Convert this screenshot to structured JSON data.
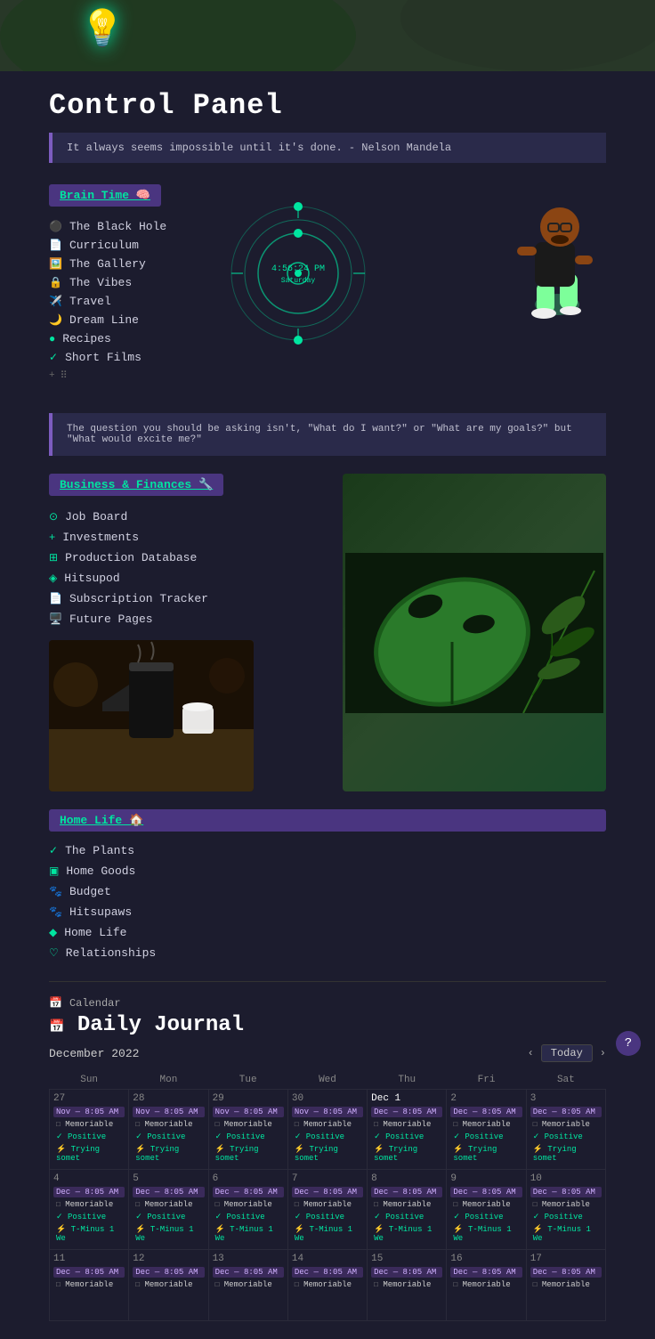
{
  "hero": {
    "alt": "Plant background hero"
  },
  "page": {
    "title": "Control Panel",
    "quote1": "It always seems impossible until it's done. - Nelson Mandela",
    "quote2": "The question you should be asking isn't, \"What do I want?\" or \"What are my goals?\" but \"What would excite me?\""
  },
  "brain_section": {
    "header": "Brain Time 🧠",
    "items": [
      {
        "icon": "⚫",
        "label": "The Black Hole",
        "icon_type": "gray"
      },
      {
        "icon": "📄",
        "label": "Curriculum",
        "icon_type": "teal"
      },
      {
        "icon": "🖼️",
        "label": "The Gallery",
        "icon_type": "teal"
      },
      {
        "icon": "🔒",
        "label": "The Vibes",
        "icon_type": "teal"
      },
      {
        "icon": "✈️",
        "label": "Travel",
        "icon_type": "teal"
      },
      {
        "icon": "🌙",
        "label": "Dream Line",
        "icon_type": "teal"
      },
      {
        "icon": "🟢",
        "label": "Recipes",
        "icon_type": "green"
      },
      {
        "icon": "✓",
        "label": "Short Films",
        "icon_type": "teal"
      }
    ]
  },
  "clock": {
    "time": "4:56:24 PM",
    "day": "Saturday"
  },
  "business_section": {
    "header": "Business & Finances 🔧",
    "items": [
      {
        "icon": "⊙",
        "label": "Job Board"
      },
      {
        "icon": "+",
        "label": "Investments"
      },
      {
        "icon": "⊞",
        "label": "Production Database"
      },
      {
        "icon": "◈",
        "label": "Hitsupod"
      },
      {
        "icon": "📄",
        "label": "Subscription Tracker"
      },
      {
        "icon": "🖥️",
        "label": "Future Pages"
      }
    ]
  },
  "home_section": {
    "header": "Home Life 🏠",
    "items": [
      {
        "icon": "✓",
        "label": "The Plants"
      },
      {
        "icon": "▣",
        "label": "Home Goods"
      },
      {
        "icon": "🐾",
        "label": "Budget"
      },
      {
        "icon": "🐾",
        "label": "Hitsupaws"
      },
      {
        "icon": "◆",
        "label": "Home Life"
      },
      {
        "icon": "♡",
        "label": "Relationships"
      }
    ]
  },
  "calendar": {
    "section_label": "Calendar",
    "journal_title": "Daily Journal",
    "month": "December 2022",
    "today_label": "Today",
    "days_of_week": [
      "Sun",
      "Mon",
      "Tue",
      "Wed",
      "Thu",
      "Fri",
      "Sat"
    ],
    "weeks": [
      [
        {
          "num": "27",
          "prev": true,
          "events": [
            {
              "type": "purple",
              "text": "Nov — 8:05 AM"
            },
            {
              "type": "check",
              "text": "Memoriable"
            },
            {
              "type": "green",
              "text": "Positive"
            },
            {
              "type": "gray",
              "text": "Trying somet"
            }
          ]
        },
        {
          "num": "28",
          "prev": true,
          "events": [
            {
              "type": "purple",
              "text": "Nov — 8:05 AM"
            },
            {
              "type": "check",
              "text": "Memoriable"
            },
            {
              "type": "green",
              "text": "Positive"
            },
            {
              "type": "gray",
              "text": "Trying somet"
            }
          ]
        },
        {
          "num": "29",
          "prev": true,
          "events": [
            {
              "type": "purple",
              "text": "Nov — 8:05 AM"
            },
            {
              "type": "check",
              "text": "Memoriable"
            },
            {
              "type": "green",
              "text": "Positive"
            },
            {
              "type": "gray",
              "text": "Trying somet"
            }
          ]
        },
        {
          "num": "30",
          "prev": true,
          "events": [
            {
              "type": "purple",
              "text": "Nov — 8:05 AM"
            },
            {
              "type": "check",
              "text": "Memoriable"
            },
            {
              "type": "green",
              "text": "Positive"
            },
            {
              "type": "gray",
              "text": "Trying somet"
            }
          ]
        },
        {
          "num": "Dec 1",
          "highlight": true,
          "events": [
            {
              "type": "purple",
              "text": "Dec — 8:05 AM"
            },
            {
              "type": "check",
              "text": "Memoriable"
            },
            {
              "type": "green",
              "text": "Positive"
            },
            {
              "type": "gray",
              "text": "Trying somet"
            }
          ]
        },
        {
          "num": "2",
          "events": [
            {
              "type": "purple",
              "text": "Dec — 8:05 AM"
            },
            {
              "type": "check",
              "text": "Memoriable"
            },
            {
              "type": "green",
              "text": "Positive"
            },
            {
              "type": "gray",
              "text": "Trying somet"
            }
          ]
        },
        {
          "num": "3",
          "events": [
            {
              "type": "purple",
              "text": "Dec — 8:05 AM"
            },
            {
              "type": "check",
              "text": "Memoriable"
            },
            {
              "type": "green",
              "text": "Positive"
            },
            {
              "type": "gray",
              "text": "Trying somet"
            }
          ]
        }
      ],
      [
        {
          "num": "4",
          "events": [
            {
              "type": "purple",
              "text": "Dec — 8:05 AM"
            },
            {
              "type": "check",
              "text": "Memoriable"
            },
            {
              "type": "green",
              "text": "Positive"
            },
            {
              "type": "gray",
              "text": "T-Minus 1 We"
            }
          ]
        },
        {
          "num": "5",
          "events": [
            {
              "type": "purple",
              "text": "Dec — 8:05 AM"
            },
            {
              "type": "check",
              "text": "Memoriable"
            },
            {
              "type": "green",
              "text": "Positive"
            },
            {
              "type": "gray",
              "text": "T-Minus 1 We"
            }
          ]
        },
        {
          "num": "6",
          "events": [
            {
              "type": "purple",
              "text": "Dec — 8:05 AM"
            },
            {
              "type": "check",
              "text": "Memoriable"
            },
            {
              "type": "green",
              "text": "Positive"
            },
            {
              "type": "gray",
              "text": "T-Minus 1 We"
            }
          ]
        },
        {
          "num": "7",
          "events": [
            {
              "type": "purple",
              "text": "Dec — 8:05 AM"
            },
            {
              "type": "check",
              "text": "Memoriable"
            },
            {
              "type": "green",
              "text": "Positive"
            },
            {
              "type": "gray",
              "text": "T-Minus 1 We"
            }
          ]
        },
        {
          "num": "8",
          "events": [
            {
              "type": "purple",
              "text": "Dec — 8:05 AM"
            },
            {
              "type": "check",
              "text": "Memoriable"
            },
            {
              "type": "green",
              "text": "Positive"
            },
            {
              "type": "gray",
              "text": "T-Minus 1 We"
            }
          ]
        },
        {
          "num": "9",
          "events": [
            {
              "type": "purple",
              "text": "Dec — 8:05 AM"
            },
            {
              "type": "check",
              "text": "Memoriable"
            },
            {
              "type": "green",
              "text": "Positive"
            },
            {
              "type": "gray",
              "text": "T-Minus 1 We"
            }
          ]
        },
        {
          "num": "10",
          "events": [
            {
              "type": "purple",
              "text": "Dec — 8:05 AM"
            },
            {
              "type": "check",
              "text": "Memoriable"
            },
            {
              "type": "green",
              "text": "Positive"
            },
            {
              "type": "gray",
              "text": "T-Minus 1 We"
            }
          ]
        }
      ],
      [
        {
          "num": "11",
          "events": [
            {
              "type": "purple",
              "text": "Dec — 8:05 AM"
            },
            {
              "type": "check",
              "text": "Memoriable"
            }
          ]
        },
        {
          "num": "12",
          "events": [
            {
              "type": "purple",
              "text": "Dec — 8:05 AM"
            },
            {
              "type": "check",
              "text": "Memoriable"
            }
          ]
        },
        {
          "num": "13",
          "events": [
            {
              "type": "purple",
              "text": "Dec — 8:05 AM"
            },
            {
              "type": "check",
              "text": "Memoriable"
            }
          ]
        },
        {
          "num": "14",
          "events": [
            {
              "type": "purple",
              "text": "Dec — 8:05 AM"
            },
            {
              "type": "check",
              "text": "Memoriable"
            }
          ]
        },
        {
          "num": "15",
          "events": [
            {
              "type": "purple",
              "text": "Dec — 8:05 AM"
            },
            {
              "type": "check",
              "text": "Memoriable"
            }
          ]
        },
        {
          "num": "16",
          "events": [
            {
              "type": "purple",
              "text": "Dec — 8:05 AM"
            },
            {
              "type": "check",
              "text": "Memoriable"
            }
          ]
        },
        {
          "num": "17",
          "events": [
            {
              "type": "purple",
              "text": "Dec — 8:05 AM"
            },
            {
              "type": "check",
              "text": "Memoriable"
            }
          ]
        }
      ]
    ]
  },
  "help_button": "?"
}
